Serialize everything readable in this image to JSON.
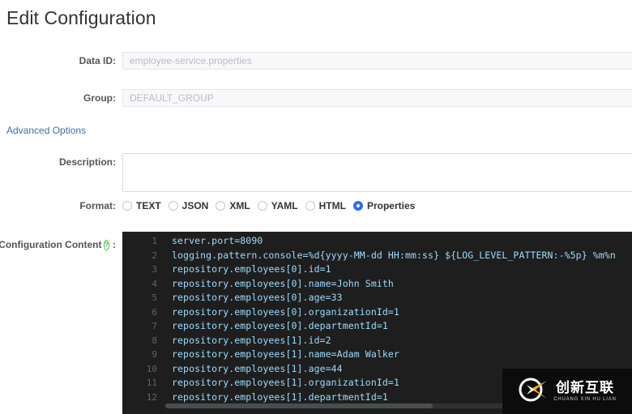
{
  "page": {
    "title": "Edit Configuration"
  },
  "form": {
    "data_id": {
      "label": "Data ID:",
      "value": "employee-service.properties",
      "disabled": true
    },
    "group": {
      "label": "Group:",
      "value": "DEFAULT_GROUP",
      "disabled": true
    },
    "advanced_options_link": "Advanced Options",
    "description": {
      "label": "Description:",
      "value": "",
      "placeholder": ""
    },
    "format": {
      "label": "Format:",
      "selected": "Properties",
      "options": [
        "TEXT",
        "JSON",
        "XML",
        "YAML",
        "HTML",
        "Properties"
      ]
    },
    "configuration_content": {
      "label": "Configuration Content",
      "help_icon": "question-mark-icon",
      "colon": ":"
    }
  },
  "editor": {
    "line_numbers": [
      "1",
      "2",
      "3",
      "4",
      "5",
      "6",
      "7",
      "8",
      "9",
      "10",
      "11",
      "12"
    ],
    "lines": [
      "server.port=8090",
      "logging.pattern.console=%d{yyyy-MM-dd HH:mm:ss} ${LOG_LEVEL_PATTERN:-%5p} %m%n",
      "repository.employees[0].id=1",
      "repository.employees[0].name=John Smith",
      "repository.employees[0].age=33",
      "repository.employees[0].organizationId=1",
      "repository.employees[0].departmentId=1",
      "repository.employees[1].id=2",
      "repository.employees[1].name=Adam Walker",
      "repository.employees[1].age=44",
      "repository.employees[1].organizationId=1",
      "repository.employees[1].departmentId=1"
    ]
  },
  "watermark": {
    "logo_icon": "cx-logo-icon",
    "chinese_text": "创新互联",
    "pinyin_text": "CHUANG XIN HU LIAN"
  },
  "colors": {
    "accent": "#2b6ef2",
    "link": "#3b6ea8",
    "help_green": "#5cb85c",
    "editor_bg": "#1e1e1e",
    "code_text": "#9cdcfe",
    "gutter_text": "#606366"
  }
}
